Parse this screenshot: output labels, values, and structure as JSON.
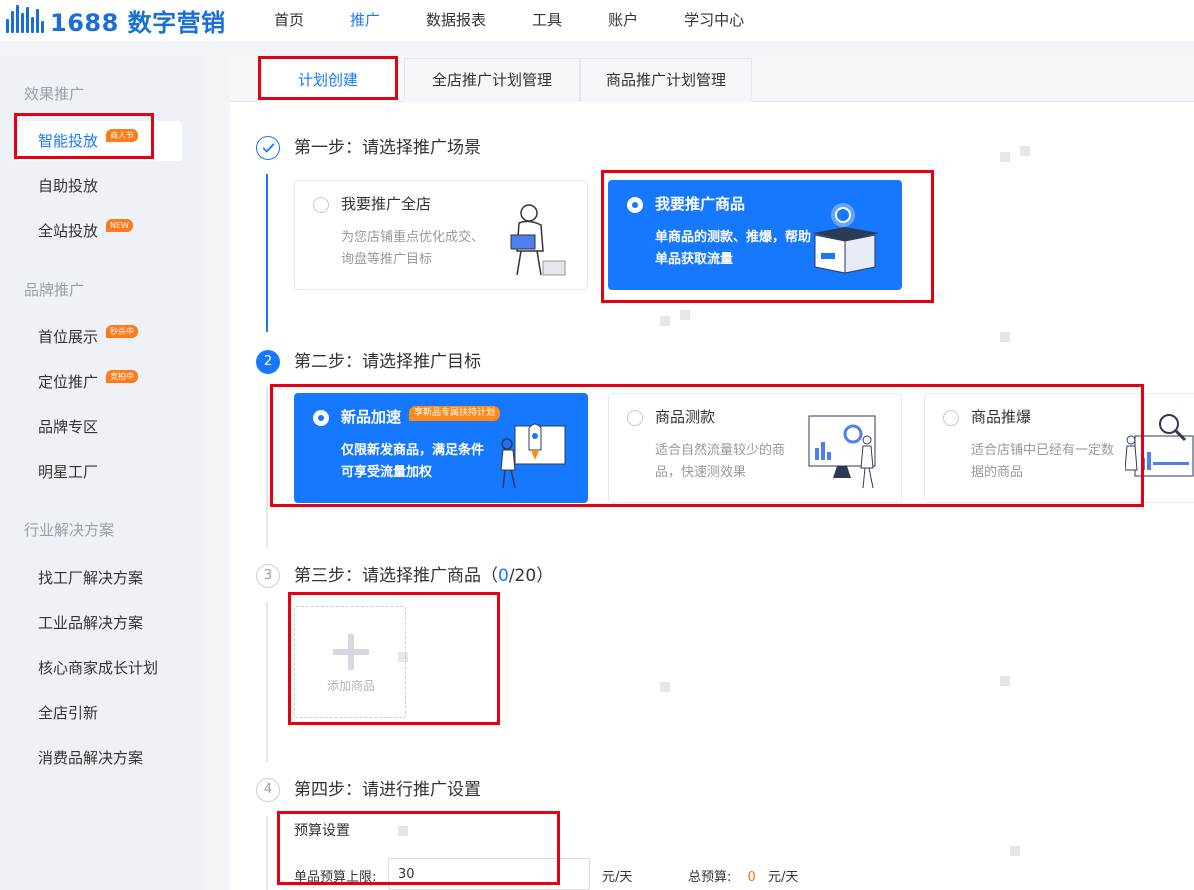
{
  "header": {
    "logo_number": "1688",
    "logo_text": "数字营销",
    "nav": [
      "首页",
      "推广",
      "数据报表",
      "工具",
      "账户",
      "学习中心"
    ],
    "active_nav": "推广"
  },
  "sidebar": {
    "groups": [
      {
        "label": "效果推广"
      },
      {
        "label": "品牌推广"
      },
      {
        "label": "行业解决方案"
      }
    ],
    "items": [
      {
        "label": "智能投放",
        "badge": "商人节",
        "active": true
      },
      {
        "label": "自助投放"
      },
      {
        "label": "全站投放",
        "badge": "NEW"
      },
      {
        "label": "首位展示",
        "badge": "秒杀中"
      },
      {
        "label": "定位推广",
        "badge": "竞拍中"
      },
      {
        "label": "品牌专区"
      },
      {
        "label": "明星工厂"
      },
      {
        "label": "找工厂解决方案"
      },
      {
        "label": "工业品解决方案"
      },
      {
        "label": "核心商家成长计划"
      },
      {
        "label": "全店引新"
      },
      {
        "label": "消费品解决方案"
      }
    ]
  },
  "tabs": [
    "计划创建",
    "全店推广计划管理",
    "商品推广计划管理"
  ],
  "steps": {
    "step1": {
      "title": "第一步：请选择推广场景",
      "cards": [
        {
          "title": "我要推广全店",
          "desc": "为您店铺重点优化成交、询盘等推广目标",
          "selected": false
        },
        {
          "title": "我要推广商品",
          "desc": "单商品的测款、推爆，帮助单品获取流量",
          "selected": true
        }
      ]
    },
    "step2": {
      "num": "2",
      "title": "第二步：请选择推广目标",
      "cards": [
        {
          "title": "新品加速",
          "badge": "享新品专属扶持计划",
          "desc": "仅限新发商品，满足条件可享受流量加权",
          "selected": true
        },
        {
          "title": "商品测款",
          "desc": "适合自然流量较少的商品，快速测效果",
          "selected": false
        },
        {
          "title": "商品推爆",
          "desc": "适合店铺中已经有一定数据的商品",
          "selected": false
        }
      ]
    },
    "step3": {
      "num": "3",
      "title_prefix": "第三步：请选择推广商品（",
      "count": "0",
      "title_suffix": "/20）",
      "add_label": "添加商品"
    },
    "step4": {
      "num": "4",
      "title": "第四步：请进行推广设置",
      "budget_title": "预算设置",
      "budget_label": "单品预算上限:",
      "budget_value": "30",
      "budget_unit": "元/天",
      "total_label": "总预算:",
      "total_value": "0",
      "total_unit": "元/天"
    }
  },
  "colors": {
    "primary": "#1677ff",
    "highlight": "#e60012",
    "accent": "#ff6a00"
  }
}
